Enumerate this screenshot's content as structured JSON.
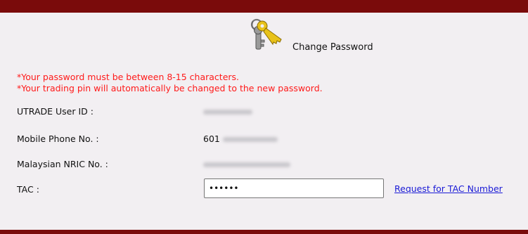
{
  "header": {
    "title": "Change Password",
    "icon": "keys-icon"
  },
  "notes": [
    "*Your password must be between 8-15 characters.",
    "*Your trading pin will automatically be changed to the new password."
  ],
  "form": {
    "user_id_label": "UTRADE User ID :",
    "mobile_label": "Mobile Phone No. :",
    "mobile_value_prefix": "601",
    "nric_label": "Malaysian NRIC No. :",
    "tac_label": "TAC :",
    "tac_value": "••••••",
    "tac_link": "Request for TAC Number"
  },
  "colors": {
    "top_bar": "#7a0b0b",
    "background": "#f2eff2",
    "warning_text": "#ff1a1a",
    "link": "#1a1ad6"
  }
}
